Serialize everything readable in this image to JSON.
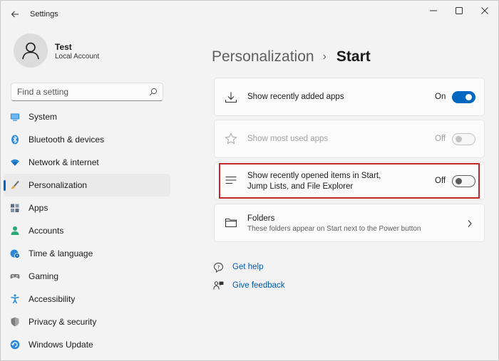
{
  "window": {
    "title": "Settings",
    "controls": {
      "minimize": "minimize-icon",
      "maximize": "maximize-icon",
      "close": "close-icon"
    }
  },
  "user": {
    "name": "Test",
    "account_type": "Local Account"
  },
  "search": {
    "placeholder": "Find a setting"
  },
  "nav": {
    "items": [
      {
        "label": "System",
        "icon": "system-icon",
        "color": "#2b88d8"
      },
      {
        "label": "Bluetooth & devices",
        "icon": "bluetooth-icon",
        "color": "#2b88d8"
      },
      {
        "label": "Network & internet",
        "icon": "wifi-icon",
        "color": "#2b88d8"
      },
      {
        "label": "Personalization",
        "icon": "brush-icon",
        "color": "#e8a33d",
        "active": true
      },
      {
        "label": "Apps",
        "icon": "apps-icon",
        "color": "#5a6b82"
      },
      {
        "label": "Accounts",
        "icon": "accounts-icon",
        "color": "#2aa876"
      },
      {
        "label": "Time & language",
        "icon": "globe-clock-icon",
        "color": "#2b88d8"
      },
      {
        "label": "Gaming",
        "icon": "gamepad-icon",
        "color": "#7d7d7d"
      },
      {
        "label": "Accessibility",
        "icon": "accessibility-icon",
        "color": "#2b88d8"
      },
      {
        "label": "Privacy & security",
        "icon": "shield-icon",
        "color": "#7d7d7d"
      },
      {
        "label": "Windows Update",
        "icon": "update-icon",
        "color": "#2b88d8"
      }
    ]
  },
  "breadcrumb": {
    "parent": "Personalization",
    "separator": "›",
    "current": "Start"
  },
  "settings": {
    "recently_added": {
      "label": "Show recently added apps",
      "state": "On",
      "icon": "download-icon"
    },
    "most_used": {
      "label": "Show most used apps",
      "state": "Off",
      "icon": "star-icon"
    },
    "recently_opened": {
      "label_line1": "Show recently opened items in Start,",
      "label_line2": "Jump Lists, and File Explorer",
      "state": "Off",
      "icon": "list-icon"
    },
    "folders": {
      "label": "Folders",
      "description": "These folders appear on Start next to the Power button",
      "icon": "folder-icon"
    }
  },
  "links": {
    "get_help": "Get help",
    "give_feedback": "Give feedback"
  },
  "colors": {
    "accent": "#0067c0",
    "highlight_border": "#c4262e",
    "link": "#0058a8"
  }
}
